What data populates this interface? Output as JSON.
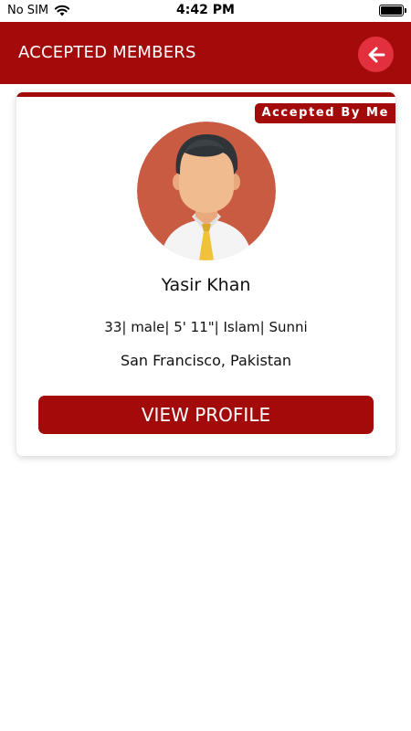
{
  "status_bar": {
    "carrier": "No SIM",
    "time": "4:42 PM"
  },
  "header": {
    "title": "ACCEPTED MEMBERS",
    "back_icon": "arrow-left-icon"
  },
  "member": {
    "badge": "Accepted By Me",
    "avatar_icon": "male-avatar-icon",
    "name": "Yasir Khan",
    "details": "33| male| 5' 11\"| Islam| Sunni",
    "location": "San Francisco, Pakistan",
    "view_profile_label": "VIEW PROFILE"
  },
  "colors": {
    "primary": "#a30b0b",
    "back_button": "#e2303e",
    "avatar_background": "#c95b43"
  }
}
